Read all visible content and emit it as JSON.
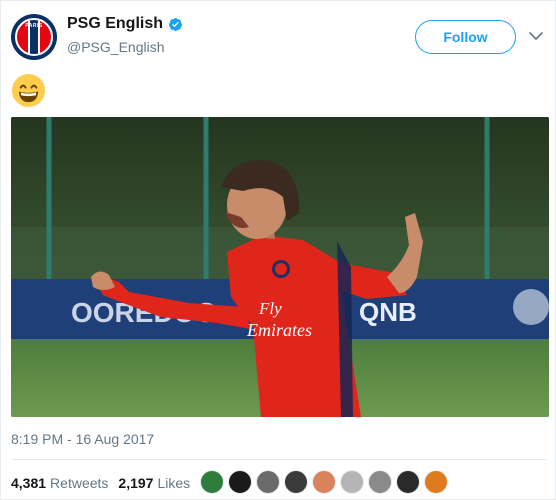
{
  "account": {
    "display_name": "PSG English",
    "handle": "@PSG_English",
    "verified": true,
    "avatar_text": "PARIS",
    "follow_label": "Follow"
  },
  "tweet": {
    "emoji": "grinning-face-with-smiling-eyes",
    "photo": {
      "banner_left": "OOREDOO",
      "banner_right": "QNB",
      "shirt_text_1": "Fly",
      "shirt_text_2": "Emirates"
    },
    "timestamp": "8:19 PM - 16 Aug 2017"
  },
  "stats": {
    "retweets_count": "4,381",
    "retweets_label": "Retweets",
    "likes_count": "2,197",
    "likes_label": "Likes",
    "liker_avatar_count": 9
  },
  "colors": {
    "accent": "#1da1f2",
    "muted": "#657786",
    "border": "#e6ecf0",
    "psg_blue": "#0a3066",
    "psg_red": "#e30613"
  }
}
